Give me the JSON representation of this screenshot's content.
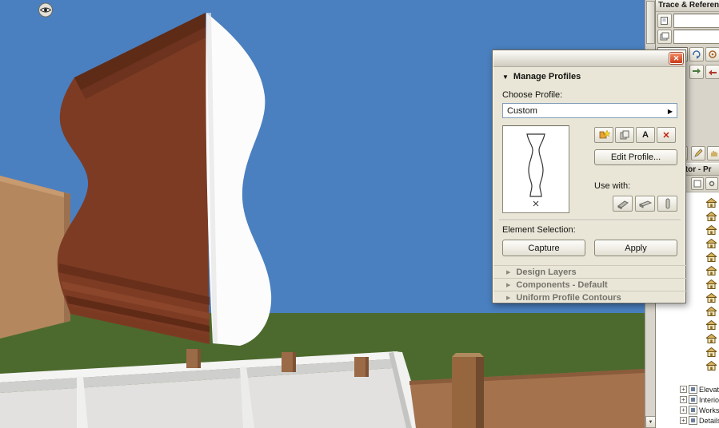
{
  "icons": {
    "dropdown_arrow": "▶",
    "close": "✕",
    "collapsed_triangle": "▶",
    "expanded_triangle": "▼",
    "scroll_down": "▼",
    "rename_glyph": "A",
    "delete_glyph": "✕",
    "expand_plus": "+"
  },
  "dialog": {
    "title": "Manage Profiles",
    "choose_profile_label": "Choose Profile:",
    "profile_value": "Custom",
    "edit_profile_label": "Edit Profile...",
    "use_with_label": "Use with:",
    "element_selection_label": "Element Selection:",
    "capture_label": "Capture",
    "apply_label": "Apply",
    "sections": [
      {
        "label": "Design Layers"
      },
      {
        "label": "Components - Default"
      },
      {
        "label": "Uniform Profile Contours"
      }
    ]
  },
  "right_panel": {
    "trace_title": "Trace & Reference",
    "navigator_title": "Navigator - Pr",
    "story_count": 13,
    "bottom_items": [
      {
        "label": "Elevations"
      },
      {
        "label": "Interior Elevations"
      },
      {
        "label": "Worksheets"
      },
      {
        "label": "Details"
      }
    ]
  },
  "colors": {
    "sky": "#4a80c0",
    "ground": "#4c6a2d",
    "profile_brown": "#7d3b24",
    "profile_face": "#fcfcfc",
    "accent_close": "#c93a17"
  }
}
